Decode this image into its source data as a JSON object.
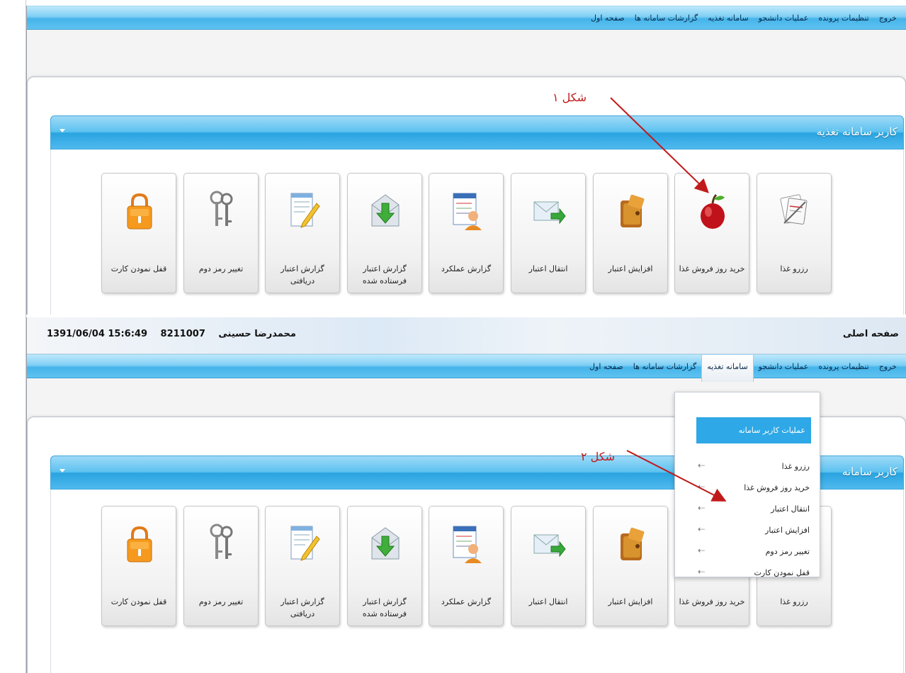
{
  "nav": [
    {
      "label": "صفحه اول"
    },
    {
      "label": "گزارشات سامانه ها"
    },
    {
      "label": "سامانه تغذیه"
    },
    {
      "label": "عملیات دانشجو"
    },
    {
      "label": "تنظیمات پرونده"
    },
    {
      "label": "خروج"
    }
  ],
  "header2": {
    "home_title": "صفحه اصلی",
    "user_name": "محمدرضا حسینی",
    "user_id": "8211007",
    "datetime": "1391/06/04 15:6:49"
  },
  "module": {
    "title": "کاربر سامانه تغذیه",
    "title_truncated": "کاربر سامانه"
  },
  "tiles": [
    {
      "label": "رزرو غذا",
      "icon": "menu-note-icon"
    },
    {
      "label": "خرید روز فروش غذا",
      "icon": "apple-icon"
    },
    {
      "label": "افزایش اعتبار",
      "icon": "wallet-icon"
    },
    {
      "label": "انتقال اعتبار",
      "icon": "mail-transfer-icon"
    },
    {
      "label": "گزارش عملکرد",
      "icon": "user-report-icon"
    },
    {
      "label": "گزارش اعتبار فرستاده شده",
      "icon": "envelope-download-icon"
    },
    {
      "label": "گزارش اعتبار دریافتی",
      "icon": "document-edit-icon"
    },
    {
      "label": "تغییر رمز دوم",
      "icon": "keys-icon"
    },
    {
      "label": "قفل نمودن کارت",
      "icon": "lock-icon"
    }
  ],
  "annotations": {
    "fig1": "شکل ۱",
    "fig2": "شکل ۲"
  },
  "dropdown": {
    "header": "عملیات کاربر سامانه",
    "items": [
      {
        "label": "رزرو غذا",
        "arrow": "⇠"
      },
      {
        "label": "خرید روز فروش غذا",
        "arrow": "⇠"
      },
      {
        "label": "انتقال اعتبار",
        "arrow": "⇠"
      },
      {
        "label": "افزایش اعتبار",
        "arrow": "⇠"
      },
      {
        "label": "تغییر رمز دوم",
        "arrow": "⇠"
      },
      {
        "label": "قفل نمودن کارت",
        "arrow": "⇠"
      }
    ]
  },
  "colors": {
    "annotation": "#c11a1a",
    "header_blue": "#2aa3e0",
    "dropdown_header": "#2ea8e6"
  }
}
